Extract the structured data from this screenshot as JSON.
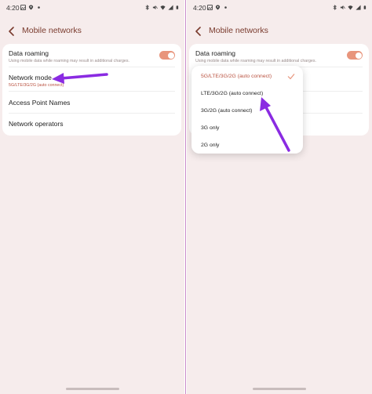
{
  "status_bar": {
    "time": "4:20"
  },
  "header": {
    "title": "Mobile networks"
  },
  "settings": {
    "data_roaming": {
      "title": "Data roaming",
      "subtitle": "Using mobile data while roaming may result in additional charges.",
      "enabled": true
    },
    "network_mode": {
      "title": "Network mode",
      "value": "5G/LTE/3G/2G (auto connect)"
    },
    "apn": {
      "title": "Access Point Names"
    },
    "operators": {
      "title": "Network operators"
    }
  },
  "network_mode_dropdown": {
    "options": [
      "5G/LTE/3G/2G (auto connect)",
      "LTE/3G/2G (auto connect)",
      "3G/2G (auto connect)",
      "3G only",
      "2G only"
    ],
    "selected_index": 0
  },
  "colors": {
    "accent": "#b9513f",
    "toggle_on": "#e8957c",
    "background": "#f6ecec",
    "annotation_arrow": "#8a2be2"
  }
}
